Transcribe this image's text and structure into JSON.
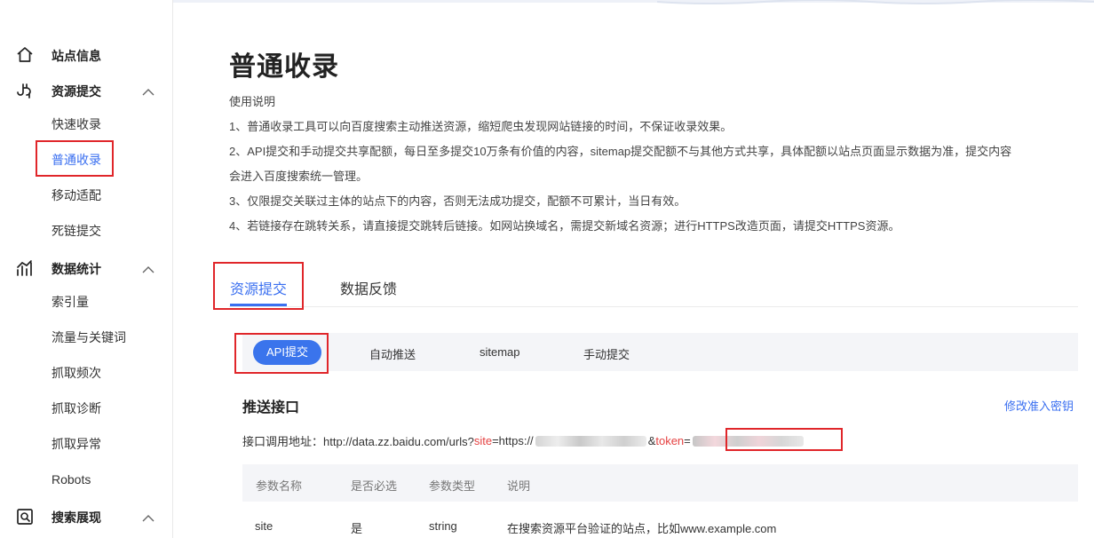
{
  "sidebar": {
    "groups": [
      {
        "label": "站点信息",
        "icon": "home-icon",
        "items": []
      },
      {
        "label": "资源提交",
        "icon": "submit-resource-icon",
        "expanded": true,
        "items": [
          "快速收录",
          "普通收录",
          "移动适配",
          "死链提交"
        ]
      },
      {
        "label": "数据统计",
        "icon": "stats-icon",
        "expanded": true,
        "items": [
          "索引量",
          "流量与关键词",
          "抓取频次",
          "抓取诊断",
          "抓取异常",
          "Robots"
        ]
      },
      {
        "label": "搜索展现",
        "icon": "search-display-icon",
        "expanded": true,
        "items": []
      }
    ],
    "active_item": "普通收录"
  },
  "main": {
    "title": "普通收录",
    "instructions": [
      "使用说明",
      "1、普通收录工具可以向百度搜索主动推送资源，缩短爬虫发现网站链接的时间，不保证收录效果。",
      "2、API提交和手动提交共享配额，每日至多提交10万条有价值的内容，sitemap提交配额不与其他方式共享，具体配额以站点页面显示数据为准，提交内容",
      "会进入百度搜索统一管理。",
      "3、仅限提交关联过主体的站点下的内容，否则无法成功提交，配额不可累计，当日有效。",
      "4、若链接存在跳转关系，请直接提交跳转后链接。如网站换域名，需提交新域名资源；进行HTTPS改造页面，请提交HTTPS资源。"
    ],
    "tabs": [
      {
        "label": "资源提交",
        "active": true
      },
      {
        "label": "数据反馈",
        "active": false
      }
    ],
    "subtabs": [
      {
        "label": "API提交",
        "active": true
      },
      {
        "label": "自动推送",
        "active": false
      },
      {
        "label": "sitemap",
        "active": false
      },
      {
        "label": "手动提交",
        "active": false
      }
    ],
    "push": {
      "title": "推送接口",
      "modify_link": "修改准入密钥",
      "api_prefix": "接口调用地址：http://data.zz.baidu.com/urls?",
      "site_key": "site",
      "eq1": "=https://",
      "amp": "&",
      "token_key": "token",
      "eq2": "="
    },
    "table": {
      "headers": [
        "参数名称",
        "是否必选",
        "参数类型",
        "说明"
      ],
      "rows": [
        [
          "site",
          "是",
          "string",
          "在搜索资源平台验证的站点，比如www.example.com"
        ]
      ]
    }
  },
  "colors": {
    "accent": "#3a6ff0",
    "highlight_box": "#e0262a",
    "param_key": "#e54242"
  }
}
